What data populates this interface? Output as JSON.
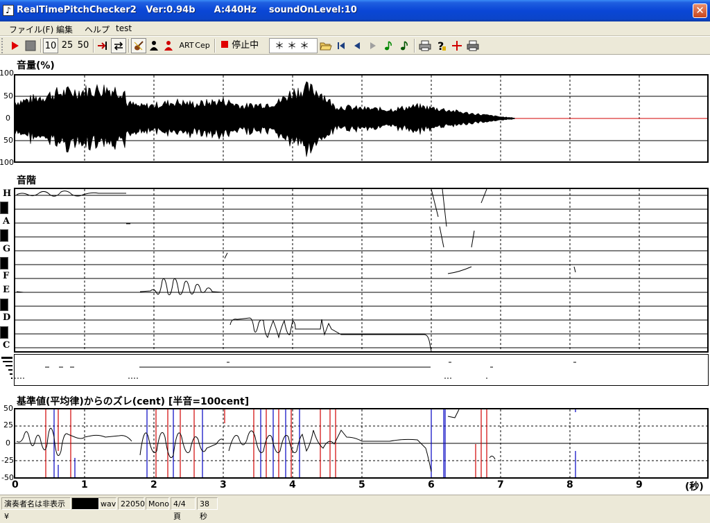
{
  "window": {
    "title": "RealTimePitchChecker2   Ver:0.94b      A:440Hz    soundOnLevel:10",
    "close": "✕"
  },
  "menu": [
    "ファイル(F)",
    "編集",
    "ヘルプ",
    "test"
  ],
  "toolbar": {
    "n10": "10",
    "n25": "25",
    "n50": "50",
    "art": "ART",
    "cep": "Cep",
    "stopped": "停止中",
    "stars": "＊＊＊"
  },
  "volume": {
    "title": "音量(%)",
    "ticks": [
      "100",
      "50",
      "0",
      "50",
      "100"
    ]
  },
  "scale": {
    "title": "音階",
    "notes": [
      "H",
      "A",
      "G",
      "F",
      "E",
      "D",
      "C"
    ]
  },
  "cent": {
    "title": "基準値(平均律)からのズレ(cent) [半音=100cent]",
    "ticks": [
      "50",
      "25",
      "0",
      "-25",
      "-50"
    ]
  },
  "xaxis": {
    "ticks": [
      "0",
      "1",
      "2",
      "3",
      "4",
      "5",
      "6",
      "7",
      "8",
      "9"
    ],
    "unit": "(秒)"
  },
  "statusbar": {
    "performer": "演奏者名は非表示¥",
    "ext": "wav",
    "rate": "22050",
    "channel": "Mono",
    "page": "4/4頁",
    "length": "38秒"
  }
}
